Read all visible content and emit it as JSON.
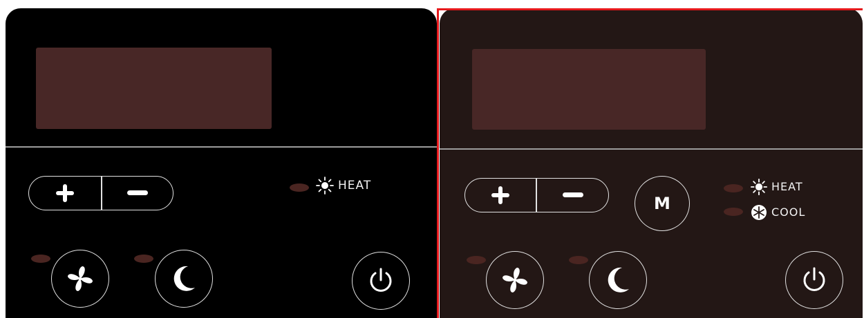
{
  "panels": [
    {
      "variant": "heat-only",
      "background": "#000000",
      "display_color": "#482726",
      "led_off_color": "#4a2521",
      "buttons": {
        "increase_icon": "plus-icon",
        "decrease_icon": "minus-icon",
        "fan_icon": "fan-icon",
        "sleep_icon": "moon-icon",
        "power_icon": "power-icon"
      },
      "modes": [
        {
          "label": "HEAT",
          "icon": "sun-icon",
          "active": false
        }
      ]
    },
    {
      "variant": "heat-cool",
      "selected": true,
      "background": "#231715",
      "display_color": "#482726",
      "led_off_color": "#4a2521",
      "buttons": {
        "increase_icon": "plus-icon",
        "decrease_icon": "minus-icon",
        "mode_label": "M",
        "fan_icon": "fan-icon",
        "sleep_icon": "moon-icon",
        "power_icon": "power-icon"
      },
      "modes": [
        {
          "label": "HEAT",
          "icon": "sun-icon",
          "active": false
        },
        {
          "label": "COOL",
          "icon": "snowflake-icon",
          "active": false
        }
      ]
    }
  ],
  "selection_color": "#e6191c"
}
